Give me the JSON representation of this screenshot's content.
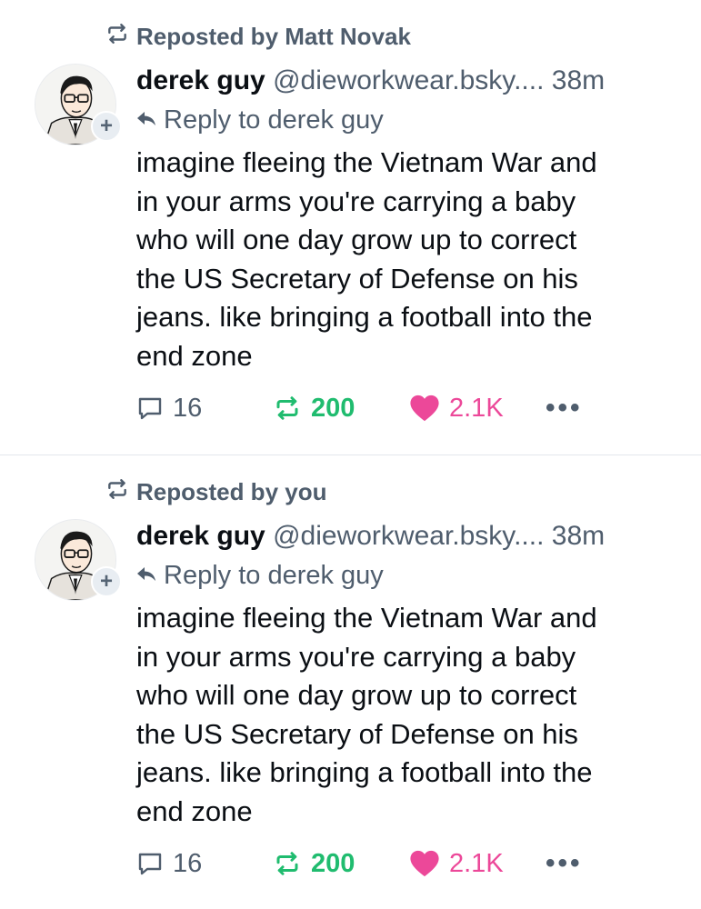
{
  "posts": [
    {
      "repost_label": "Reposted by Matt Novak",
      "author_name": "derek guy",
      "author_handle": "@dieworkwear.bsky....",
      "time": "38m",
      "follow_glyph": "+",
      "reply_to": "Reply to derek guy",
      "text_lines": [
        "imagine fleeing the Vietnam War and",
        "in your arms you're carrying a baby",
        "who will one day grow up to correct",
        "the US Secretary of Defense on his",
        "jeans. like bringing a football into the",
        "end zone"
      ],
      "reply_count": "16",
      "repost_count": "200",
      "like_count": "2.1K",
      "more_glyph": "•••"
    },
    {
      "repost_label": "Reposted by you",
      "author_name": "derek guy",
      "author_handle": "@dieworkwear.bsky....",
      "time": "38m",
      "follow_glyph": "+",
      "reply_to": "Reply to derek guy",
      "text_lines": [
        "imagine fleeing the Vietnam War and",
        "in your arms you're carrying a baby",
        "who will one day grow up to correct",
        "the US Secretary of Defense on his",
        "jeans. like bringing a football into the",
        "end zone"
      ],
      "reply_count": "16",
      "repost_count": "200",
      "like_count": "2.1K",
      "more_glyph": "•••"
    }
  ],
  "icons": {
    "repost": "repost-icon",
    "reply_arrow": "reply-arrow-icon",
    "comment": "comment-icon",
    "like": "heart-icon",
    "more": "more-options-icon"
  },
  "colors": {
    "repost_active": "#20bc6f",
    "like_active": "#ec4899",
    "muted": "#4f5d6d"
  }
}
